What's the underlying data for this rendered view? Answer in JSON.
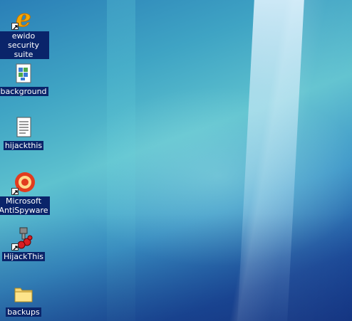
{
  "desktop": {
    "icons": [
      {
        "label": "ewido security suite",
        "icon": "ewido-e-icon",
        "shortcut": true
      },
      {
        "label": "background",
        "icon": "registry-file-icon",
        "shortcut": false
      },
      {
        "label": "hijackthis",
        "icon": "text-file-icon",
        "shortcut": false
      },
      {
        "label": "Microsoft AntiSpyware",
        "icon": "microsoft-antispyware-icon",
        "shortcut": true
      },
      {
        "label": "HijackThis",
        "icon": "hijackthis-program-icon",
        "shortcut": true
      },
      {
        "label": "backups",
        "icon": "folder-icon",
        "shortcut": false
      }
    ]
  }
}
